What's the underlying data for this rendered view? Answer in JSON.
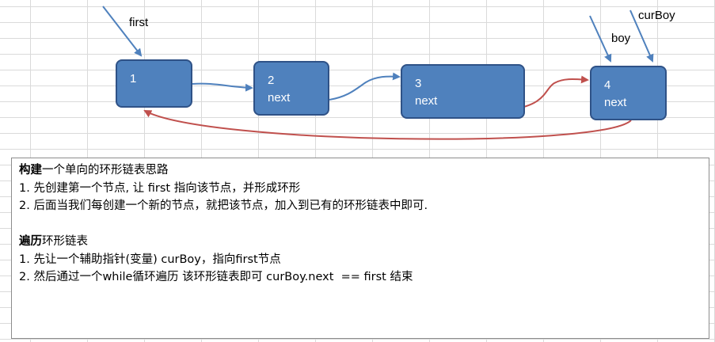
{
  "diagram": {
    "pointers": {
      "first": "first",
      "boy": "boy",
      "curboy": "curBoy"
    },
    "nodes": [
      {
        "num": "1",
        "next": ""
      },
      {
        "num": "2",
        "next": "next"
      },
      {
        "num": "3",
        "next": "next"
      },
      {
        "num": "4",
        "next": "next"
      }
    ],
    "colors": {
      "node_fill": "#4f81bd",
      "node_border": "#2f5287",
      "link_arrow": "#4f81bd",
      "back_arrow": "#c0504d"
    }
  },
  "notes": {
    "build_head": "构建",
    "build_rest": "一个单向的环形链表思路",
    "build_step1": "1. 先创建第一个节点, 让 first 指向该节点，并形成环形",
    "build_step2": "2. 后面当我们每创建一个新的节点，就把该节点，加入到已有的环形链表中即可.",
    "traverse_head": "遍历",
    "traverse_rest": "环形链表",
    "traverse_step1": "1. 先让一个辅助指针(变量) curBoy，指向first节点",
    "traverse_step2": "2. 然后通过一个while循环遍历 该环形链表即可 curBoy.next  == first 结束"
  }
}
